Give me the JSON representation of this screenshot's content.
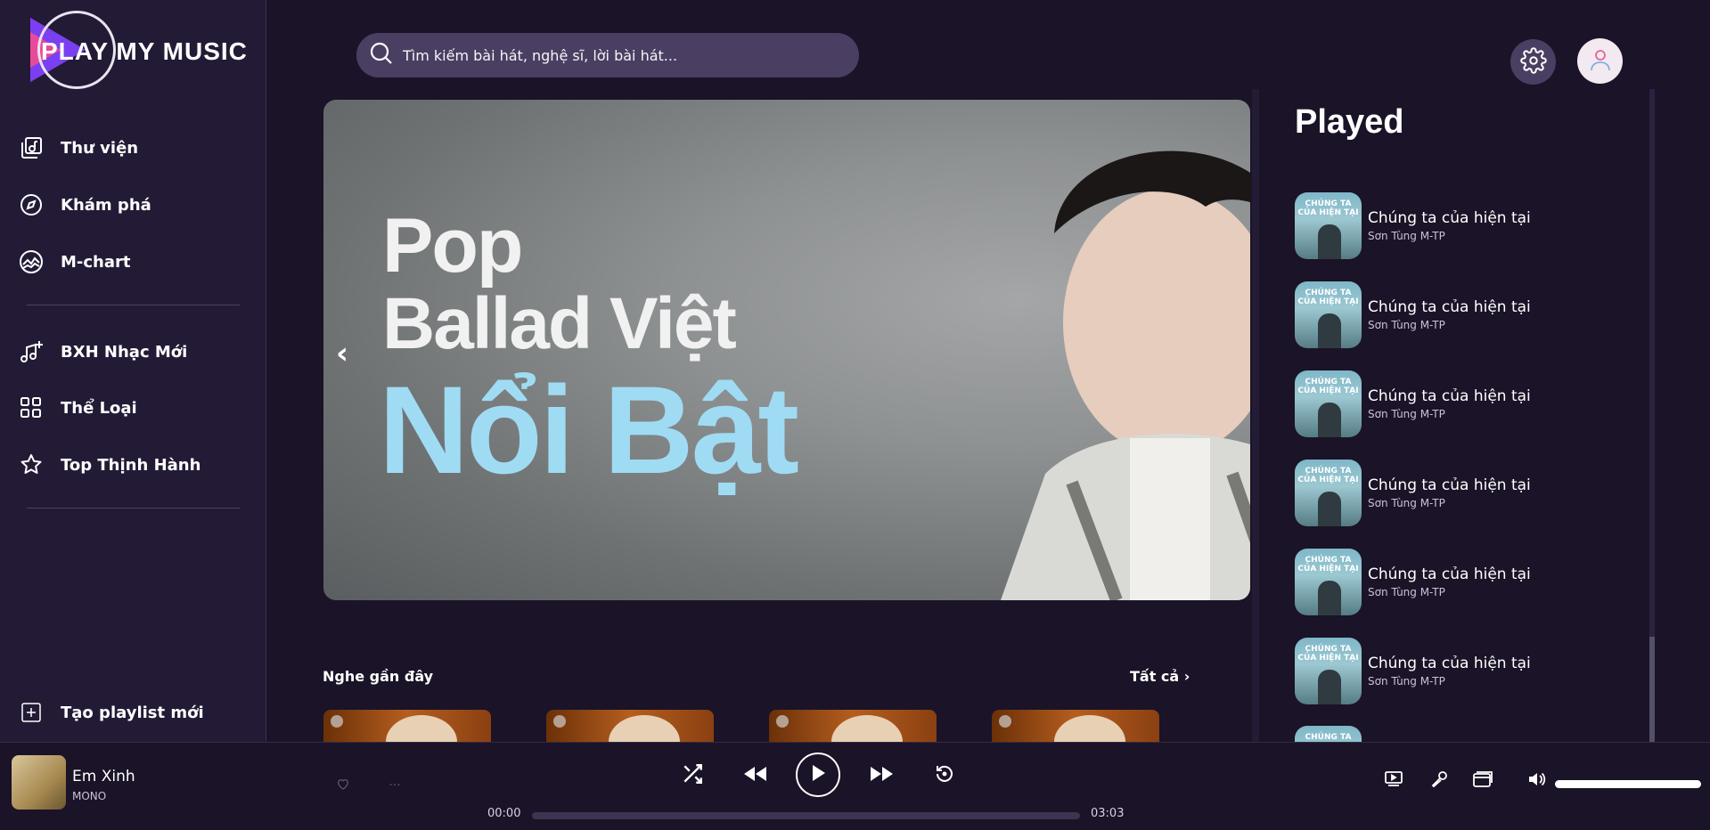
{
  "app": {
    "logo_text_play": "PLAY",
    "logo_text_rest": "MY MUSIC"
  },
  "sidebar": {
    "items": [
      {
        "label": "Thư viện",
        "icon": "library-icon"
      },
      {
        "label": "Khám phá",
        "icon": "compass-icon"
      },
      {
        "label": "M-chart",
        "icon": "chart-icon"
      },
      {
        "label": "BXH Nhạc Mới",
        "icon": "music-add-icon"
      },
      {
        "label": "Thể Loại",
        "icon": "grid-icon"
      },
      {
        "label": "Top Thịnh Hành",
        "icon": "star-icon"
      }
    ],
    "create_playlist": "Tạo playlist mới"
  },
  "search": {
    "placeholder": "Tìm kiếm bài hát, nghệ sĩ, lời bài hát..."
  },
  "banner": {
    "line1": "Pop",
    "line2": "Ballad Việt",
    "line3": "Nổi Bật",
    "prev": "‹"
  },
  "recent": {
    "title": "Nghe gần đây",
    "all": "Tất cả"
  },
  "played": {
    "title": "Played",
    "items": [
      {
        "song": "Chúng ta của hiện tại",
        "artist": "Sơn Tùng M-TP",
        "cover_text": "CHÚNG TA CỦA HIỆN TẠI"
      },
      {
        "song": "Chúng ta của hiện tại",
        "artist": "Sơn Tùng M-TP",
        "cover_text": "CHÚNG TA CỦA HIỆN TẠI"
      },
      {
        "song": "Chúng ta của hiện tại",
        "artist": "Sơn Tùng M-TP",
        "cover_text": "CHÚNG TA CỦA HIỆN TẠI"
      },
      {
        "song": "Chúng ta của hiện tại",
        "artist": "Sơn Tùng M-TP",
        "cover_text": "CHÚNG TA CỦA HIỆN TẠI"
      },
      {
        "song": "Chúng ta của hiện tại",
        "artist": "Sơn Tùng M-TP",
        "cover_text": "CHÚNG TA CỦA HIỆN TẠI"
      },
      {
        "song": "Chúng ta của hiện tại",
        "artist": "Sơn Tùng M-TP",
        "cover_text": "CHÚNG TA CỦA HIỆN TẠI"
      }
    ],
    "partial_cover_text": "CHÚNG TA"
  },
  "player": {
    "title": "Em Xinh",
    "artist": "MONO",
    "current_time": "00:00",
    "total_time": "03:03",
    "progress": 0,
    "volume": 1.0
  },
  "colors": {
    "background": "#1b1327",
    "sidebar": "#231b36",
    "search_bg": "#4a3f62",
    "accent_text": "#9fdcf4"
  }
}
